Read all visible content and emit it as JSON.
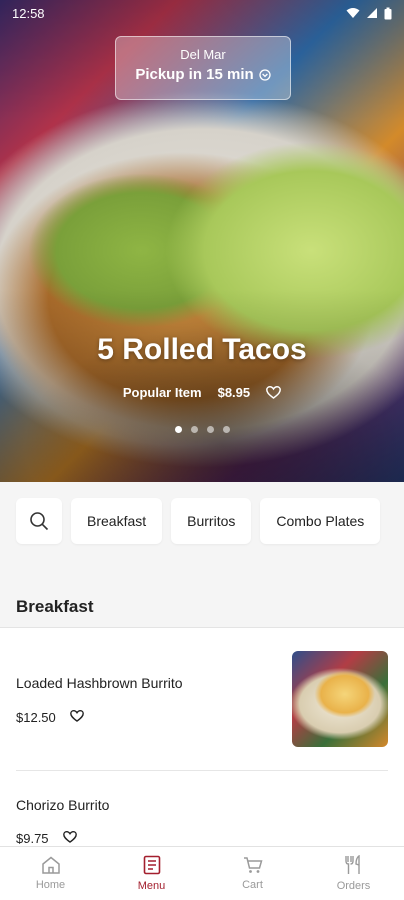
{
  "status_bar": {
    "time": "12:58"
  },
  "pickup": {
    "store": "Del Mar",
    "time_label": "Pickup in 15 min"
  },
  "hero": {
    "title": "5 Rolled Tacos",
    "tag": "Popular Item",
    "price": "$8.95",
    "slides": [
      true,
      false,
      false,
      false
    ]
  },
  "categories": [
    {
      "label": "Breakfast"
    },
    {
      "label": "Burritos"
    },
    {
      "label": "Combo Plates"
    }
  ],
  "section": {
    "title": "Breakfast"
  },
  "items": [
    {
      "name": "Loaded Hashbrown Burrito",
      "price": "$12.50",
      "has_image": true
    },
    {
      "name": "Chorizo Burrito",
      "price": "$9.75",
      "has_image": false
    }
  ],
  "nav": [
    {
      "label": "Home",
      "icon": "home-icon"
    },
    {
      "label": "Menu",
      "icon": "menu-icon",
      "active": true
    },
    {
      "label": "Cart",
      "icon": "cart-icon"
    },
    {
      "label": "Orders",
      "icon": "orders-icon"
    }
  ],
  "colors": {
    "accent": "#a31f2e",
    "inactive": "#9a9a9a"
  }
}
